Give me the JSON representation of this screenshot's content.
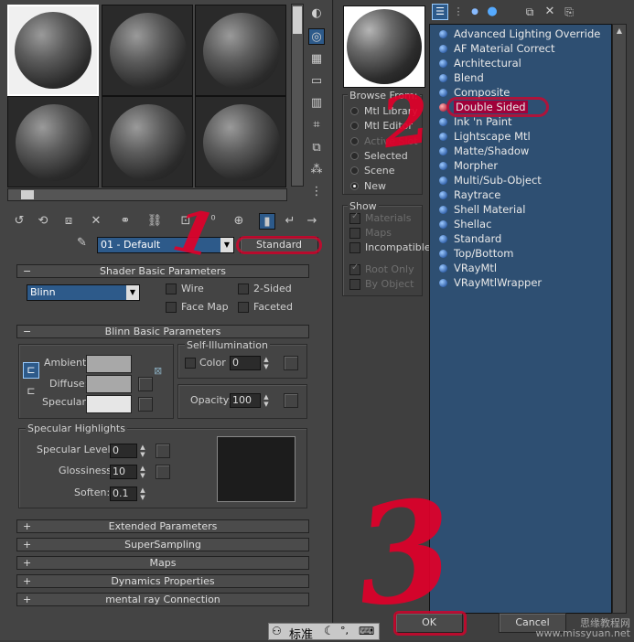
{
  "left_panel": {
    "material_name": "01 - Default",
    "material_type_button": "Standard",
    "rollouts": {
      "shader_basic": "Shader Basic Parameters",
      "blinn_basic": "Blinn Basic Parameters",
      "extended": "Extended Parameters",
      "supersampling": "SuperSampling",
      "maps": "Maps",
      "dynamics": "Dynamics Properties",
      "mental_ray": "mental ray Connection"
    },
    "rollout_collapsed_sign": "+",
    "rollout_expanded_sign": "−",
    "shader": {
      "selected": "Blinn",
      "wire": "Wire",
      "two_sided": "2-Sided",
      "face_map": "Face Map",
      "faceted": "Faceted"
    },
    "blinn": {
      "ambient_label": "Ambient:",
      "diffuse_label": "Diffuse:",
      "specular_label": "Specular:",
      "self_illum_title": "Self-Illumination",
      "color_label": "Color",
      "color_value": "0",
      "opacity_label": "Opacity:",
      "opacity_value": "100",
      "ambient_color": "#a8a8a8",
      "diffuse_color": "#a8a8a8",
      "specular_color": "#e6e6e6"
    },
    "specular_highlights": {
      "title": "Specular Highlights",
      "level_label": "Specular Level:",
      "level_value": "0",
      "gloss_label": "Glossiness:",
      "gloss_value": "10",
      "soften_label": "Soften:",
      "soften_value": "0.1"
    },
    "annotation_1": "1"
  },
  "right_panel": {
    "browse_from": {
      "title": "Browse From:",
      "options": [
        "Mtl Library",
        "Mtl Editor",
        "Active Slot",
        "Selected",
        "Scene",
        "New"
      ],
      "selected": "New"
    },
    "show": {
      "title": "Show",
      "materials": "Materials",
      "maps": "Maps",
      "incompatible": "Incompatible",
      "root_only": "Root Only",
      "by_object": "By Object"
    },
    "materials_list": [
      "Advanced Lighting Override",
      "AF Material Correct",
      "Architectural",
      "Blend",
      "Composite",
      "Double Sided",
      "Ink 'n Paint",
      "Lightscape Mtl",
      "Matte/Shadow",
      "Morpher",
      "Multi/Sub-Object",
      "Raytrace",
      "Shell Material",
      "Shellac",
      "Standard",
      "Top/Bottom",
      "VRayMtl",
      "VRayMtlWrapper"
    ],
    "highlighted_item": "Double Sided",
    "ok_button": "OK",
    "cancel_button": "Cancel",
    "annotation_2": "2",
    "annotation_3": "3"
  },
  "taskbar": {
    "ime_label": "标准"
  },
  "watermark": {
    "line1": "思缘教程网",
    "line2": "www.missyuan.net"
  }
}
